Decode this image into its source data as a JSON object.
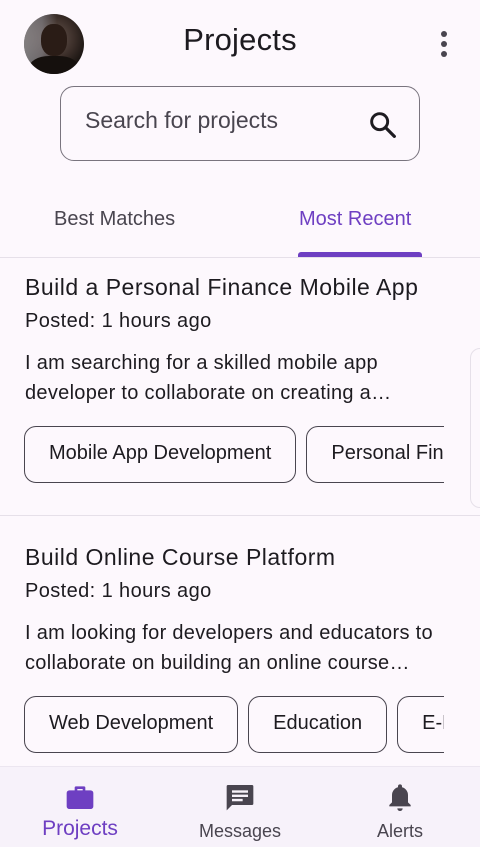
{
  "header": {
    "title": "Projects",
    "avatar_alt": "user-avatar",
    "menu_icon": "more-vert-icon"
  },
  "search": {
    "placeholder": "Search for projects",
    "icon": "search-icon"
  },
  "tabs": [
    {
      "label": "Best Matches",
      "selected": false
    },
    {
      "label": "Most Recent",
      "selected": true
    }
  ],
  "projects": [
    {
      "title": "Build a Personal Finance Mobile App",
      "posted": "Posted: 1 hours ago",
      "description": "I am searching for a skilled mobile app developer to collaborate on creating a personal finance mobile app",
      "tags": [
        "Mobile App Development",
        "Personal Finance"
      ]
    },
    {
      "title": "Build Online Course Platform",
      "posted": "Posted: 1 hours ago",
      "description": "I am looking for developers and educators to collaborate on building an online course platform",
      "tags": [
        "Web Development",
        "Education",
        "E-Learning"
      ]
    }
  ],
  "bottom_nav": [
    {
      "label": "Projects",
      "icon": "briefcase-icon",
      "active": true
    },
    {
      "label": "Messages",
      "icon": "message-icon",
      "active": false
    },
    {
      "label": "Alerts",
      "icon": "bell-icon",
      "active": false
    }
  ],
  "colors": {
    "accent": "#6e3fc2",
    "background": "#fdf8fd",
    "text": "#1d1b20",
    "muted": "#49454f",
    "nav_background": "#f7f2fa"
  }
}
